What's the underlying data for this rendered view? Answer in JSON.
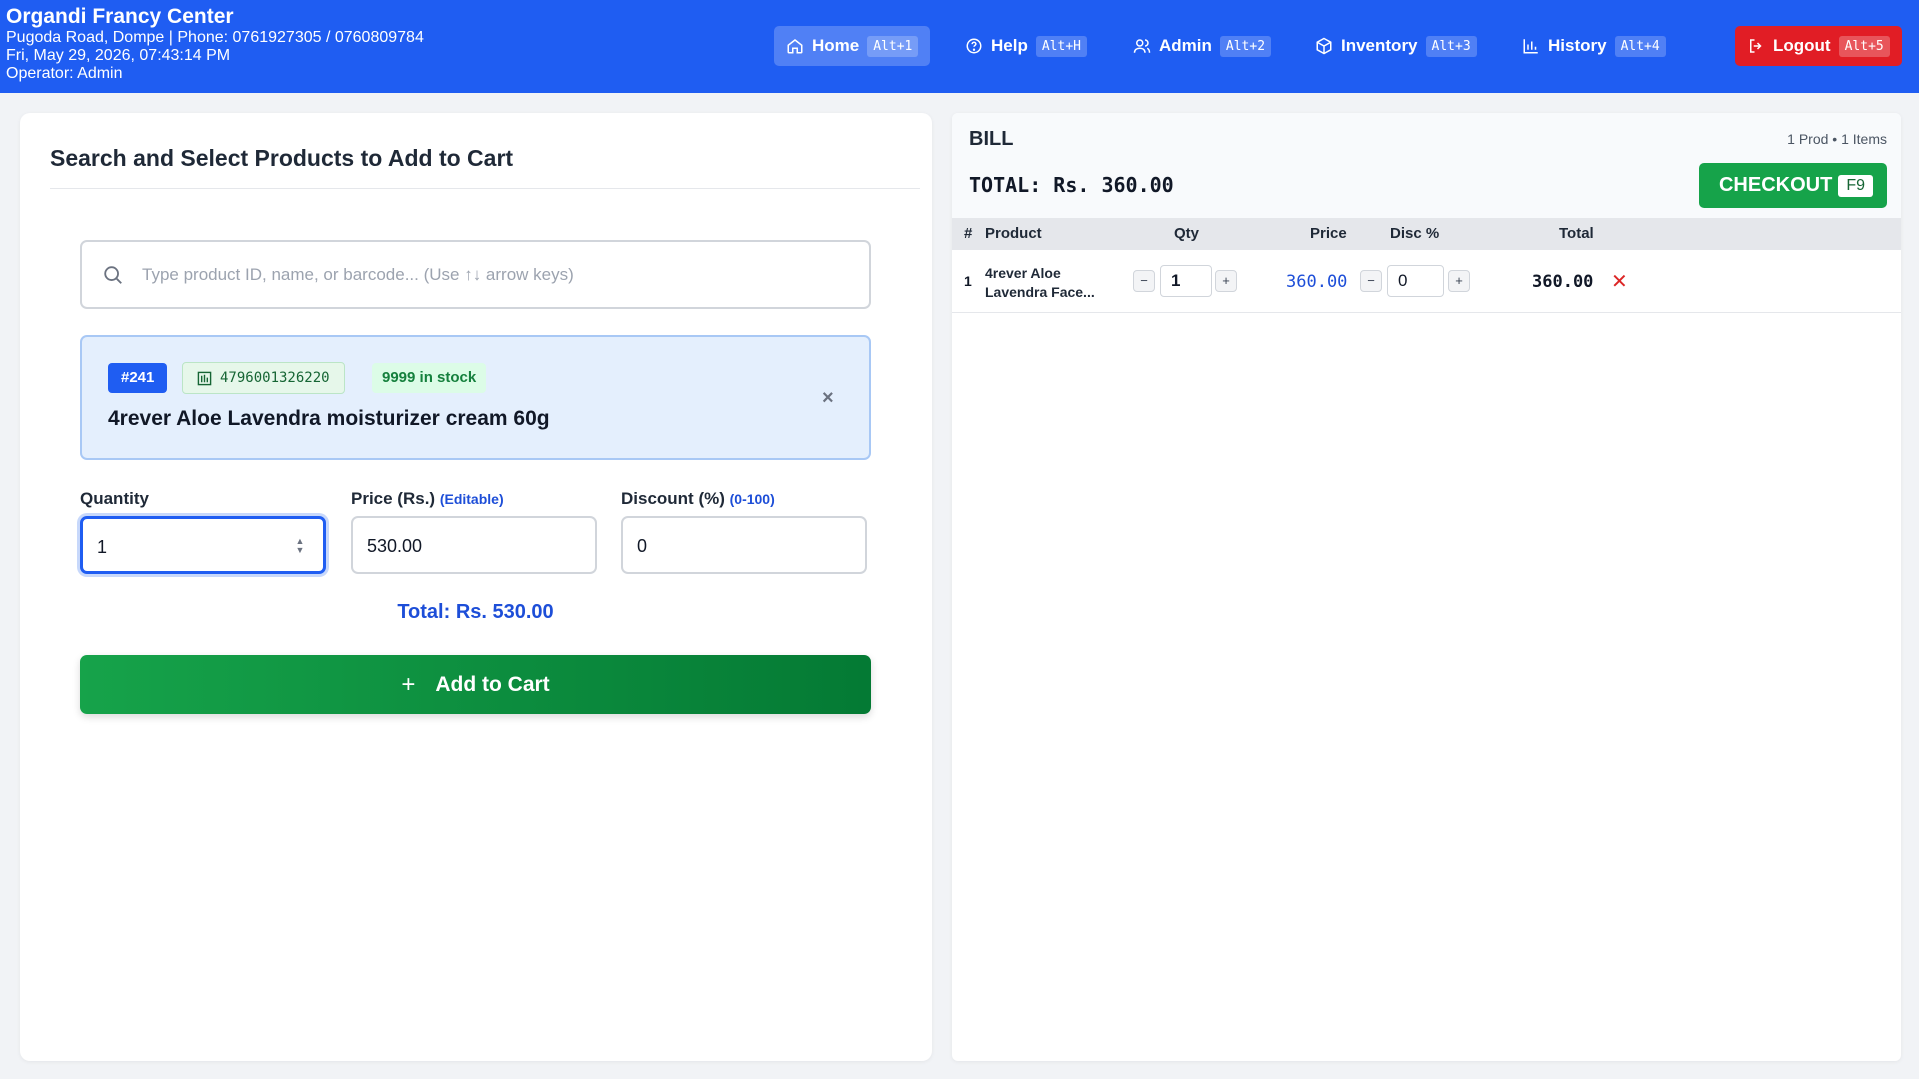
{
  "header": {
    "store_name": "Organdi Francy Center",
    "address_phone": "Pugoda Road, Dompe | Phone: 0761927305 / 0760809784",
    "datetime": "Fri, May 29, 2026, 07:43:14 PM",
    "operator": "Operator: Admin",
    "nav": [
      {
        "label": "Home",
        "shortcut": "Alt+1",
        "icon": "home-icon",
        "active": true
      },
      {
        "label": "Help",
        "shortcut": "Alt+H",
        "icon": "help-circle-icon"
      },
      {
        "label": "Admin",
        "shortcut": "Alt+2",
        "icon": "users-icon"
      },
      {
        "label": "Inventory",
        "shortcut": "Alt+3",
        "icon": "box-icon"
      },
      {
        "label": "History",
        "shortcut": "Alt+4",
        "icon": "bar-chart-icon"
      },
      {
        "label": "Logout",
        "shortcut": "Alt+5",
        "icon": "logout-icon"
      }
    ]
  },
  "product_search": {
    "title": "Search and Select Products to Add to Cart",
    "placeholder": "Type product ID, name, or barcode... (Use ↑↓ arrow keys)",
    "selected": {
      "id": "#241",
      "barcode": "4796001326220",
      "stock": "9999 in stock",
      "name": "4rever Aloe Lavendra moisturizer cream 60g",
      "close": "×"
    },
    "quantity_label": "Quantity",
    "quantity_value": "1",
    "price_label": "Price (Rs.)",
    "price_hint": "(Editable)",
    "price_value": "530.00",
    "discount_label": "Discount (%)",
    "discount_hint": "(0-100)",
    "discount_value": "0",
    "total": "Total: Rs. 530.00",
    "add_button": "Add to Cart",
    "add_icon": "+"
  },
  "bill": {
    "label": "BILL",
    "counts": "1 Prod  •  1 Items",
    "total": "TOTAL: Rs. 360.00",
    "checkout_label": "CHECKOUT",
    "checkout_key": "F9",
    "columns": {
      "num": "#",
      "product": "Product",
      "qty": "Qty",
      "price": "Price",
      "disc": "Disc %",
      "total": "Total"
    },
    "rows": [
      {
        "num": "1",
        "product_line1": "4rever Aloe",
        "product_line2": "Lavendra Face...",
        "qty": "1",
        "price": "360.00",
        "disc": "0",
        "total": "360.00",
        "minus": "−",
        "plus": "+",
        "remove": "✕"
      }
    ]
  },
  "colors": {
    "primary": "#1f5df2",
    "success": "#16a34a",
    "danger": "#e11d25"
  }
}
